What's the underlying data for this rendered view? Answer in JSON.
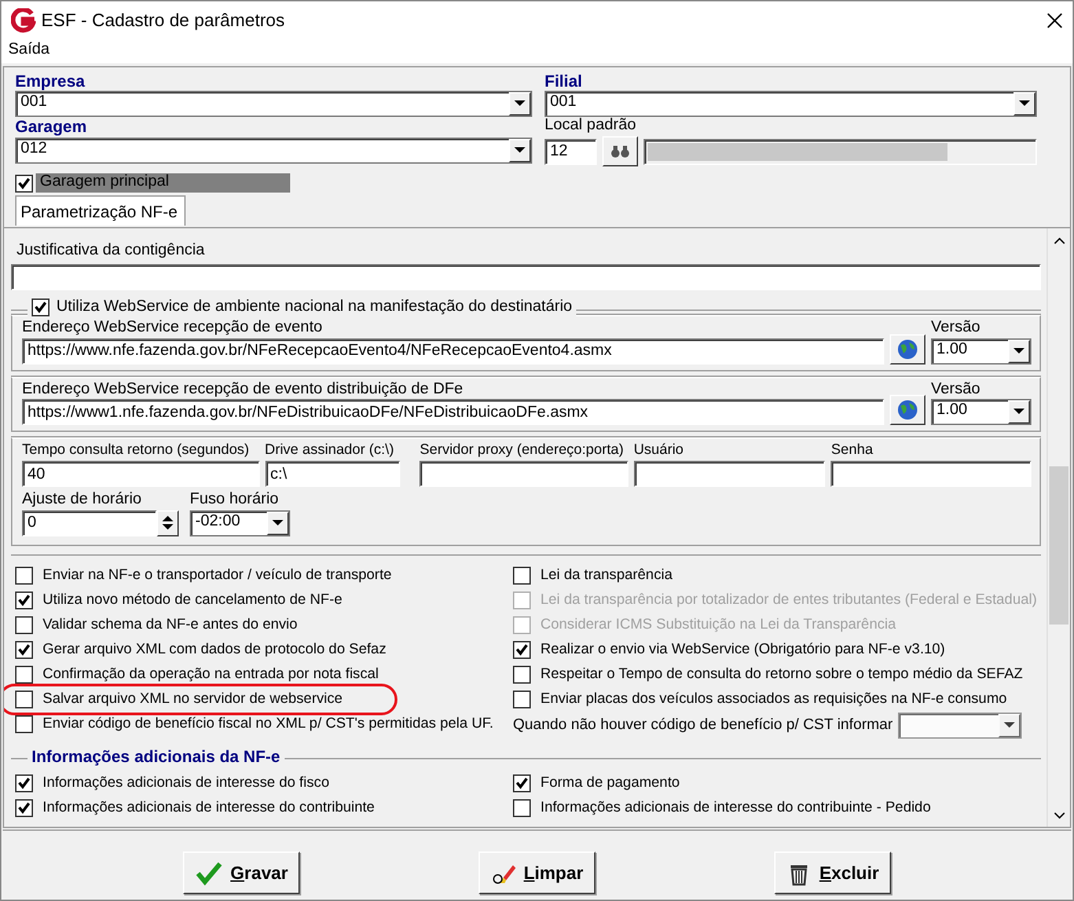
{
  "window": {
    "title": "ESF - Cadastro de parâmetros"
  },
  "menu": [
    "Saída"
  ],
  "header": {
    "empresa": {
      "label": "Empresa",
      "value": "001"
    },
    "filial": {
      "label": "Filial",
      "value": "001"
    },
    "garagem": {
      "label": "Garagem",
      "value": "012"
    },
    "local_padrao": {
      "label": "Local padrão",
      "value": "12"
    },
    "garagem_principal": {
      "label": "Garagem principal",
      "checked": true
    }
  },
  "tabs": [
    {
      "label": "Parametrização NF-e",
      "selected": true
    }
  ],
  "justificativa": {
    "label": "Justificativa da contigência"
  },
  "ambiente_nacional": {
    "label": "Utiliza WebService de ambiente nacional na manifestação do destinatário",
    "checked": true
  },
  "webservices": [
    {
      "label": "Endereço WebService recepção de evento",
      "url": "https://www.nfe.fazenda.gov.br/NFeRecepcaoEvento4/NFeRecepcaoEvento4.asmx",
      "version_label": "Versão",
      "version": "1.00"
    },
    {
      "label": "Endereço WebService recepção de evento distribuição de DFe",
      "url": "https://www1.nfe.fazenda.gov.br/NFeDistribuicaoDFe/NFeDistribuicaoDFe.asmx",
      "version_label": "Versão",
      "version": "1.00"
    }
  ],
  "fields": [
    {
      "label": "Tempo consulta retorno (segundos)",
      "value": "40"
    },
    {
      "label": "Drive assinador (c:\\)",
      "value": "c:\\"
    },
    {
      "label": "Servidor proxy (endereço:porta)"
    },
    {
      "label": "Usuário"
    },
    {
      "label": "Senha"
    }
  ],
  "ajuste_horario": {
    "label": "Ajuste de horário",
    "value": "0"
  },
  "fuso_horario": {
    "label": "Fuso horário",
    "value": "-02:00"
  },
  "options_left": [
    {
      "label": "Enviar na NF-e o transportador / veículo de transporte",
      "checked": false,
      "disabled": false
    },
    {
      "label": "Utiliza novo método de cancelamento de NF-e",
      "checked": true,
      "disabled": false
    },
    {
      "label": "Validar schema da NF-e antes do envio",
      "checked": false,
      "disabled": false
    },
    {
      "label": "Gerar arquivo XML com dados de protocolo do Sefaz",
      "checked": true,
      "disabled": false
    },
    {
      "label": "Confirmação da operação na entrada por nota fiscal",
      "checked": false,
      "disabled": false
    },
    {
      "label": "Salvar arquivo XML no servidor de webservice",
      "checked": false,
      "disabled": false
    },
    {
      "label": "Enviar código de benefício fiscal no XML p/ CST's permitidas pela UF.",
      "checked": false,
      "disabled": false
    }
  ],
  "options_right": [
    {
      "label": "Lei da transparência",
      "checked": false,
      "disabled": false
    },
    {
      "label": "Lei da transparência por totalizador de entes tributantes (Federal e Estadual)",
      "checked": false,
      "disabled": true
    },
    {
      "label": "Considerar ICMS Substituição na Lei da Transparência",
      "checked": false,
      "disabled": true
    },
    {
      "label": "Realizar o envio via WebService (Obrigatório para NF-e v3.10)",
      "checked": true,
      "disabled": false
    },
    {
      "label": "Respeitar o Tempo de consulta do retorno sobre o tempo médio da SEFAZ",
      "checked": false,
      "disabled": false
    },
    {
      "label": "Enviar placas dos veículos associados as requisições na NF-e consumo",
      "checked": false,
      "disabled": false
    }
  ],
  "beneficio_cst": {
    "label": "Quando não houver código de benefício p/ CST informar"
  },
  "info_adicionais": {
    "title": "Informações adicionais da NF-e",
    "left": [
      {
        "label": "Informações adicionais de interesse do fisco",
        "checked": true
      },
      {
        "label": "Informações adicionais de interesse do contribuinte",
        "checked": true
      }
    ],
    "right": [
      {
        "label": "Forma de pagamento",
        "checked": true
      },
      {
        "label": "Informações adicionais de interesse do contribuinte - Pedido",
        "checked": false
      }
    ]
  },
  "buttons": [
    {
      "label": "Gravar",
      "kind": "save"
    },
    {
      "label": "Limpar",
      "kind": "clear"
    },
    {
      "label": "Excluir",
      "kind": "delete"
    }
  ]
}
